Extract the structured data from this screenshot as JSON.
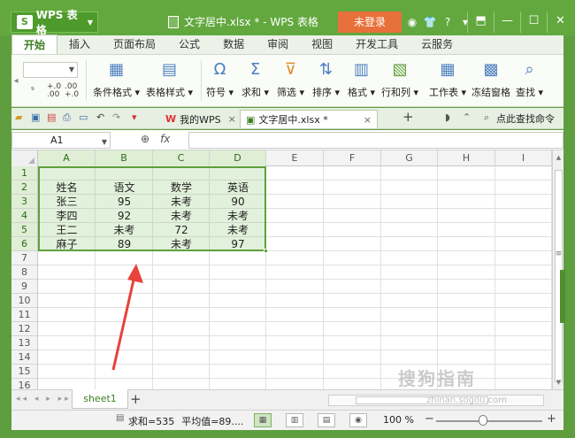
{
  "titlebar": {
    "app_name": "WPS 表格",
    "app_logo": "S",
    "doc_title": "文字居中.xlsx * - WPS 表格",
    "login_label": "未登录",
    "icons": [
      "skin-icon",
      "shirt-icon",
      "help-icon",
      "menu-icon"
    ],
    "icon_glyphs": [
      "◉",
      "👕",
      "?",
      "▾"
    ],
    "controls": [
      "⬒",
      "—",
      "☐",
      "✕"
    ]
  },
  "ribbon": {
    "tabs": [
      "开始",
      "插入",
      "页面布局",
      "公式",
      "数据",
      "审阅",
      "视图",
      "开发工具",
      "云服务"
    ],
    "active_tab": "开始",
    "groups": [
      {
        "label": "条件格式 ▾",
        "icon": "conditional-format-icon",
        "glyph": "▦"
      },
      {
        "label": "表格样式 ▾",
        "icon": "table-style-icon",
        "glyph": "▤"
      },
      {
        "label": "符号 ▾",
        "icon": "omega-icon",
        "glyph": "Ω"
      },
      {
        "label": "求和 ▾",
        "icon": "sum-icon",
        "glyph": "Σ"
      },
      {
        "label": "筛选 ▾",
        "icon": "filter-icon",
        "glyph": "⊽"
      },
      {
        "label": "排序 ▾",
        "icon": "sort-icon",
        "glyph": "⇅"
      },
      {
        "label": "格式 ▾",
        "icon": "format-icon",
        "glyph": "▥"
      },
      {
        "label": "行和列 ▾",
        "icon": "row-col-icon",
        "glyph": "▧"
      },
      {
        "label": "工作表 ▾",
        "icon": "worksheet-icon",
        "glyph": "▦"
      },
      {
        "label": "冻结窗格",
        "icon": "freeze-icon",
        "glyph": "▩"
      },
      {
        "label": "查找 ▾",
        "icon": "find-icon",
        "glyph": "⌕"
      }
    ],
    "small_format": [
      "⁹",
      "+.0\n.00",
      ".00\n+.0"
    ]
  },
  "quickbar": {
    "doc_tabs": [
      {
        "label": "我的WPS",
        "close": "×"
      },
      {
        "label": "文字居中.xlsx *",
        "close": "×"
      }
    ],
    "add_tab": "+",
    "search_label": "点此查找命令"
  },
  "formula_bar": {
    "name_box": "A1",
    "fx_label": "fx",
    "zoom_glyph": "⊕"
  },
  "grid": {
    "columns": [
      "A",
      "B",
      "C",
      "D",
      "E",
      "F",
      "G",
      "H",
      "I"
    ],
    "rows": [
      "1",
      "2",
      "3",
      "4",
      "5",
      "6",
      "7",
      "8",
      "9",
      "10",
      "11",
      "12",
      "13",
      "14",
      "15",
      "16"
    ],
    "data": [
      [
        "",
        "",
        "",
        ""
      ],
      [
        "姓名",
        "语文",
        "数学",
        "英语"
      ],
      [
        "张三",
        "95",
        "未考",
        "90"
      ],
      [
        "李四",
        "92",
        "未考",
        "未考"
      ],
      [
        "王二",
        "未考",
        "72",
        "未考"
      ],
      [
        "麻子",
        "89",
        "未考",
        "97"
      ]
    ]
  },
  "sheets": {
    "tabs": [
      "sheet1"
    ],
    "add": "+",
    "nav": "◂◂ ◂ ▸ ▸▸"
  },
  "status": {
    "sum": "求和=535",
    "avg": "平均值=89....",
    "zoom": "100 %",
    "minus": "−",
    "plus": "+"
  },
  "watermark": {
    "text": "搜狗指南",
    "sub": "zhinan.sogou.com"
  },
  "colors": {
    "accent": "#62a83e",
    "login": "#e8703a",
    "selection": "#5ea03d",
    "arrow": "#e8423a"
  }
}
